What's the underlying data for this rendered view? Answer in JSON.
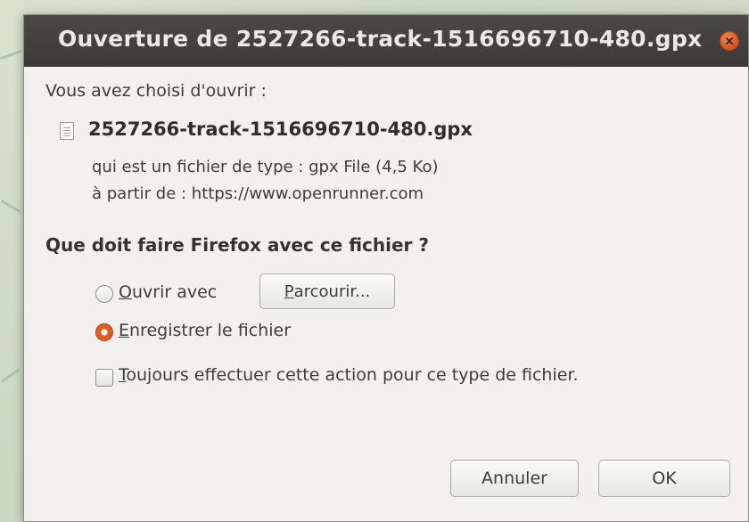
{
  "dialog": {
    "title": "Ouverture de 2527266-track-1516696710-480.gpx",
    "intro": "Vous avez choisi d'ouvrir :",
    "file_icon": "document-icon",
    "filename": "2527266-track-1516696710-480.gpx",
    "type_line": "qui est un fichier de type : gpx File (4,5 Ko)",
    "from_line": "à partir de : https://www.openrunner.com",
    "question": "Que doit faire Firefox avec ce fichier ?",
    "open_with": {
      "mnemonic": "O",
      "rest": "uvrir avec",
      "selected": false
    },
    "browse": {
      "mnemonic": "P",
      "rest": "arcourir..."
    },
    "save_file": {
      "mnemonic": "E",
      "rest": "nregistrer le fichier",
      "selected": true
    },
    "always": {
      "mnemonic": "T",
      "rest": "oujours effectuer cette action pour ce type de fichier.",
      "checked": false
    },
    "cancel_label": "Annuler",
    "ok_label": "OK"
  },
  "colors": {
    "titlebar": "#3b3a37",
    "accent": "#e45c25",
    "dialog_bg": "#f2f1ef"
  }
}
